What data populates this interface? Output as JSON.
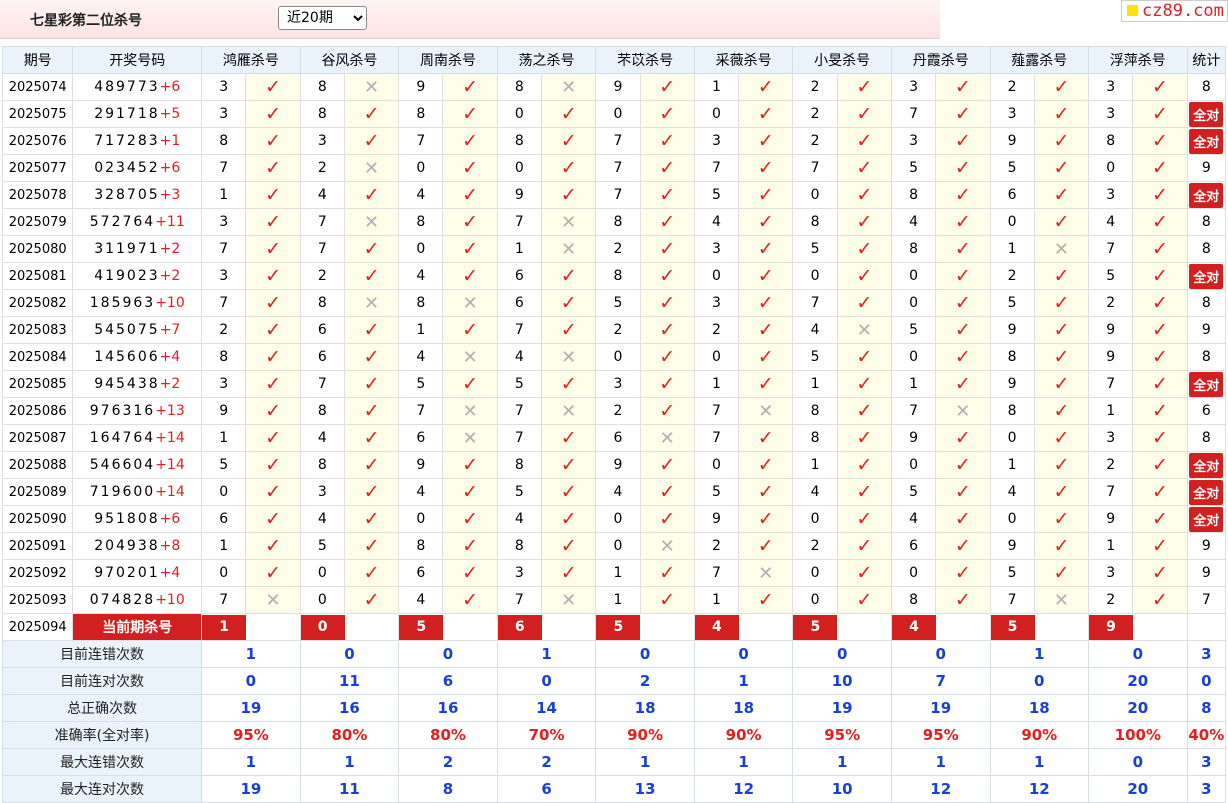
{
  "header": {
    "title": "七星彩第二位杀号",
    "period_select": "近20期",
    "logo_text": "cz89.com"
  },
  "columns": {
    "issue": "期号",
    "draw": "开奖号码",
    "experts": [
      "鸿雁杀号",
      "谷风杀号",
      "周南杀号",
      "荡之杀号",
      "芣苡杀号",
      "采薇杀号",
      "小旻杀号",
      "丹霞杀号",
      "薤露杀号",
      "浮萍杀号"
    ],
    "stat": "统计"
  },
  "rows": [
    {
      "issue": "2025074",
      "digits": "489773",
      "extra": "+6",
      "kills": [
        3,
        8,
        9,
        8,
        9,
        1,
        2,
        3,
        2,
        3
      ],
      "ok": [
        1,
        0,
        1,
        0,
        1,
        1,
        1,
        1,
        1,
        1
      ],
      "stat": "8"
    },
    {
      "issue": "2025075",
      "digits": "291718",
      "extra": "+5",
      "kills": [
        3,
        8,
        8,
        0,
        0,
        0,
        2,
        7,
        3,
        3
      ],
      "ok": [
        1,
        1,
        1,
        1,
        1,
        1,
        1,
        1,
        1,
        1
      ],
      "stat": "全对"
    },
    {
      "issue": "2025076",
      "digits": "717283",
      "extra": "+1",
      "kills": [
        8,
        3,
        7,
        8,
        7,
        3,
        2,
        3,
        9,
        8
      ],
      "ok": [
        1,
        1,
        1,
        1,
        1,
        1,
        1,
        1,
        1,
        1
      ],
      "stat": "全对"
    },
    {
      "issue": "2025077",
      "digits": "023452",
      "extra": "+6",
      "kills": [
        7,
        2,
        0,
        0,
        7,
        7,
        7,
        5,
        5,
        0
      ],
      "ok": [
        1,
        0,
        1,
        1,
        1,
        1,
        1,
        1,
        1,
        1
      ],
      "stat": "9"
    },
    {
      "issue": "2025078",
      "digits": "328705",
      "extra": "+3",
      "kills": [
        1,
        4,
        4,
        9,
        7,
        5,
        0,
        8,
        6,
        3
      ],
      "ok": [
        1,
        1,
        1,
        1,
        1,
        1,
        1,
        1,
        1,
        1
      ],
      "stat": "全对"
    },
    {
      "issue": "2025079",
      "digits": "572764",
      "extra": "+11",
      "kills": [
        3,
        7,
        8,
        7,
        8,
        4,
        8,
        4,
        0,
        4
      ],
      "ok": [
        1,
        0,
        1,
        0,
        1,
        1,
        1,
        1,
        1,
        1
      ],
      "stat": "8"
    },
    {
      "issue": "2025080",
      "digits": "311971",
      "extra": "+2",
      "kills": [
        7,
        7,
        0,
        1,
        2,
        3,
        5,
        8,
        1,
        7
      ],
      "ok": [
        1,
        1,
        1,
        0,
        1,
        1,
        1,
        1,
        0,
        1
      ],
      "stat": "8"
    },
    {
      "issue": "2025081",
      "digits": "419023",
      "extra": "+2",
      "kills": [
        3,
        2,
        4,
        6,
        8,
        0,
        0,
        0,
        2,
        5
      ],
      "ok": [
        1,
        1,
        1,
        1,
        1,
        1,
        1,
        1,
        1,
        1
      ],
      "stat": "全对"
    },
    {
      "issue": "2025082",
      "digits": "185963",
      "extra": "+10",
      "kills": [
        7,
        8,
        8,
        6,
        5,
        3,
        7,
        0,
        5,
        2
      ],
      "ok": [
        1,
        0,
        0,
        1,
        1,
        1,
        1,
        1,
        1,
        1
      ],
      "stat": "8"
    },
    {
      "issue": "2025083",
      "digits": "545075",
      "extra": "+7",
      "kills": [
        2,
        6,
        1,
        7,
        2,
        2,
        4,
        5,
        9,
        9
      ],
      "ok": [
        1,
        1,
        1,
        1,
        1,
        1,
        0,
        1,
        1,
        1
      ],
      "stat": "9"
    },
    {
      "issue": "2025084",
      "digits": "145606",
      "extra": "+4",
      "kills": [
        8,
        6,
        4,
        4,
        0,
        0,
        5,
        0,
        8,
        9
      ],
      "ok": [
        1,
        1,
        0,
        0,
        1,
        1,
        1,
        1,
        1,
        1
      ],
      "stat": "8"
    },
    {
      "issue": "2025085",
      "digits": "945438",
      "extra": "+2",
      "kills": [
        3,
        7,
        5,
        5,
        3,
        1,
        1,
        1,
        9,
        7
      ],
      "ok": [
        1,
        1,
        1,
        1,
        1,
        1,
        1,
        1,
        1,
        1
      ],
      "stat": "全对"
    },
    {
      "issue": "2025086",
      "digits": "976316",
      "extra": "+13",
      "kills": [
        9,
        8,
        7,
        7,
        2,
        7,
        8,
        7,
        8,
        1
      ],
      "ok": [
        1,
        1,
        0,
        0,
        1,
        0,
        1,
        0,
        1,
        1
      ],
      "stat": "6"
    },
    {
      "issue": "2025087",
      "digits": "164764",
      "extra": "+14",
      "kills": [
        1,
        4,
        6,
        7,
        6,
        7,
        8,
        9,
        0,
        3
      ],
      "ok": [
        1,
        1,
        0,
        1,
        0,
        1,
        1,
        1,
        1,
        1
      ],
      "stat": "8"
    },
    {
      "issue": "2025088",
      "digits": "546604",
      "extra": "+14",
      "kills": [
        5,
        8,
        9,
        8,
        9,
        0,
        1,
        0,
        1,
        2
      ],
      "ok": [
        1,
        1,
        1,
        1,
        1,
        1,
        1,
        1,
        1,
        1
      ],
      "stat": "全对"
    },
    {
      "issue": "2025089",
      "digits": "719600",
      "extra": "+14",
      "kills": [
        0,
        3,
        4,
        5,
        4,
        5,
        4,
        5,
        4,
        7
      ],
      "ok": [
        1,
        1,
        1,
        1,
        1,
        1,
        1,
        1,
        1,
        1
      ],
      "stat": "全对"
    },
    {
      "issue": "2025090",
      "digits": "951808",
      "extra": "+6",
      "kills": [
        6,
        4,
        0,
        4,
        0,
        9,
        0,
        4,
        0,
        9
      ],
      "ok": [
        1,
        1,
        1,
        1,
        1,
        1,
        1,
        1,
        1,
        1
      ],
      "stat": "全对"
    },
    {
      "issue": "2025091",
      "digits": "204938",
      "extra": "+8",
      "kills": [
        1,
        5,
        8,
        8,
        0,
        2,
        2,
        6,
        9,
        1
      ],
      "ok": [
        1,
        1,
        1,
        1,
        0,
        1,
        1,
        1,
        1,
        1
      ],
      "stat": "9"
    },
    {
      "issue": "2025092",
      "digits": "970201",
      "extra": "+4",
      "kills": [
        0,
        0,
        6,
        3,
        1,
        7,
        0,
        0,
        5,
        3
      ],
      "ok": [
        1,
        1,
        1,
        1,
        1,
        0,
        1,
        1,
        1,
        1
      ],
      "stat": "9"
    },
    {
      "issue": "2025093",
      "digits": "074828",
      "extra": "+10",
      "kills": [
        7,
        0,
        4,
        7,
        1,
        1,
        0,
        8,
        7,
        2
      ],
      "ok": [
        0,
        1,
        1,
        0,
        1,
        1,
        1,
        1,
        0,
        1
      ],
      "stat": "7"
    }
  ],
  "current": {
    "issue": "2025094",
    "label": "当前期杀号",
    "kills": [
      "1",
      "0",
      "5",
      "6",
      "5",
      "4",
      "5",
      "4",
      "5",
      "9"
    ]
  },
  "summary": [
    {
      "label": "目前连错次数",
      "values": [
        "1",
        "0",
        "0",
        "1",
        "0",
        "0",
        "0",
        "0",
        "1",
        "0"
      ],
      "total": "3",
      "red": false
    },
    {
      "label": "目前连对次数",
      "values": [
        "0",
        "11",
        "6",
        "0",
        "2",
        "1",
        "10",
        "7",
        "0",
        "20"
      ],
      "total": "0",
      "red": false
    },
    {
      "label": "总正确次数",
      "values": [
        "19",
        "16",
        "16",
        "14",
        "18",
        "18",
        "19",
        "19",
        "18",
        "20"
      ],
      "total": "8",
      "red": false
    },
    {
      "label": "准确率(全对率)",
      "values": [
        "95%",
        "80%",
        "80%",
        "70%",
        "90%",
        "90%",
        "95%",
        "95%",
        "90%",
        "100%"
      ],
      "total": "40%",
      "red": true
    },
    {
      "label": "最大连错次数",
      "values": [
        "1",
        "1",
        "2",
        "2",
        "1",
        "1",
        "1",
        "1",
        "1",
        "0"
      ],
      "total": "3",
      "red": false
    },
    {
      "label": "最大连对次数",
      "values": [
        "19",
        "11",
        "8",
        "6",
        "13",
        "12",
        "10",
        "12",
        "12",
        "20"
      ],
      "total": "3",
      "red": false
    }
  ],
  "marks": {
    "ok": "✓",
    "no": "✕"
  },
  "colors": {
    "accent_red": "#d21f1f",
    "blue_value": "#1a3fd6",
    "header_bg": "#eaf2fc",
    "mark_bg": "#fdfde8"
  }
}
